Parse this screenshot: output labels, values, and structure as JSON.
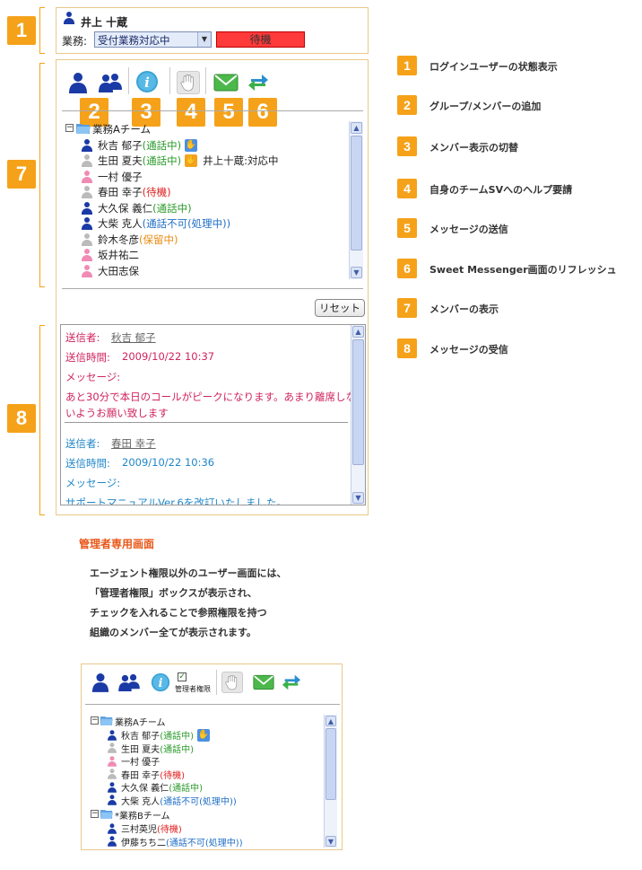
{
  "top_panel": {
    "user_name": "井上 十蔵",
    "task_label": "業務:",
    "task_select_value": "受付業務対応中",
    "status_text": "待機"
  },
  "callouts": {
    "n1": "1",
    "n7": "7",
    "n8": "8",
    "n2": "2",
    "n3": "3",
    "n4": "4",
    "n5": "5",
    "n6": "6"
  },
  "toolbar": {
    "icons": [
      "user-icon",
      "group-members-icon",
      "info-icon",
      "hand-icon",
      "mail-icon",
      "refresh-icon"
    ]
  },
  "member_tree": {
    "group_name": "業務Aチーム",
    "members": [
      {
        "name": "秋吉 郁子",
        "status": "(通話中)",
        "status_color": "green",
        "person_color": "#1a3aa6",
        "hand": "blue"
      },
      {
        "name": "生田 夏夫",
        "status": "(通話中)",
        "status_color": "green",
        "person_color": "#bbbbbb",
        "hand": "orange",
        "note": "井上十蔵:対応中"
      },
      {
        "name": "一村 優子",
        "status": "",
        "status_color": "",
        "person_color": "#f08cb4"
      },
      {
        "name": "春田 幸子",
        "status": "(待機)",
        "status_color": "red",
        "person_color": "#bbbbbb"
      },
      {
        "name": "大久保 義仁",
        "status": "(通話中)",
        "status_color": "green",
        "person_color": "#1a3aa6"
      },
      {
        "name": "大柴 克人",
        "status": "(通話不可(処理中))",
        "status_color": "blue",
        "person_color": "#1a3aa6"
      },
      {
        "name": "鈴木冬彦",
        "status": "(保留中)",
        "status_color": "orange",
        "person_color": "#bbbbbb"
      },
      {
        "name": "坂井祐二",
        "status": "",
        "status_color": "",
        "person_color": "#f08cb4"
      },
      {
        "name": "大田志保",
        "status": "",
        "status_color": "",
        "person_color": "#f08cb4"
      }
    ]
  },
  "reset_button": "リセット",
  "messages": [
    {
      "sender_label": "送信者:",
      "sender": "秋吉 郁子",
      "time_label": "送信時間:",
      "time": "2009/10/22 10:37",
      "msg_label": "メッセージ:",
      "body1": "あと30分で本日のコールがピークになります。あまり離席しな",
      "body2": "いようお願い致します",
      "color": "#d0245e"
    },
    {
      "sender_label": "送信者:",
      "sender": "春田 幸子",
      "time_label": "送信時間:",
      "time": "2009/10/22 10:36",
      "msg_label": "メッセージ:",
      "body1": "サポートマニュアルVer.6を改訂いたしました。",
      "color": "#1f86c8"
    }
  ],
  "legend": [
    {
      "num": "1",
      "text": "ログインユーザーの状態表示"
    },
    {
      "num": "2",
      "text": "グループ/メンバーの追加"
    },
    {
      "num": "3",
      "text": "メンバー表示の切替"
    },
    {
      "num": "4",
      "text": "自身のチームSVへのヘルプ要請"
    },
    {
      "num": "5",
      "text": "メッセージの送信"
    },
    {
      "num": "6",
      "text": "Sweet Messenger画面のリフレッシュ"
    },
    {
      "num": "7",
      "text": "メンバーの表示"
    },
    {
      "num": "8",
      "text": "メッセージの受信"
    }
  ],
  "admin_section": {
    "title": "管理者専用画面",
    "lines": [
      "エージェント権限以外のユーザー画面には、",
      "「管理者権限」ボックスが表示され、",
      "チェックを入れることで参照権限を持つ",
      "組織のメンバー全てが表示されます。"
    ],
    "admin_checkbox_label": "管理者権限",
    "group_a": "業務Aチーム",
    "group_b": "*業務Bチーム",
    "members": [
      {
        "name": "秋吉 郁子",
        "status": "(通話中)",
        "status_color": "green",
        "person_color": "#1a3aa6",
        "hand": "blue"
      },
      {
        "name": "生田 夏夫",
        "status": "(通話中)",
        "status_color": "green",
        "person_color": "#bbbbbb"
      },
      {
        "name": "一村 優子",
        "status": "",
        "status_color": "",
        "person_color": "#f08cb4"
      },
      {
        "name": "春田 幸子",
        "status": "(待機)",
        "status_color": "red",
        "person_color": "#bbbbbb"
      },
      {
        "name": "大久保 義仁",
        "status": "(通話中)",
        "status_color": "green",
        "person_color": "#1a3aa6"
      },
      {
        "name": "大柴 克人",
        "status": "(通話不可(処理中))",
        "status_color": "blue",
        "person_color": "#1a3aa6"
      }
    ],
    "members_b": [
      {
        "name": "三村英児",
        "status": "(待機)",
        "status_color": "red",
        "person_color": "#1a3aa6"
      },
      {
        "name": "伊藤ちち二",
        "status": "(通話不可(処理中))",
        "status_color": "blue",
        "person_color": "#1a3aa6"
      }
    ]
  }
}
